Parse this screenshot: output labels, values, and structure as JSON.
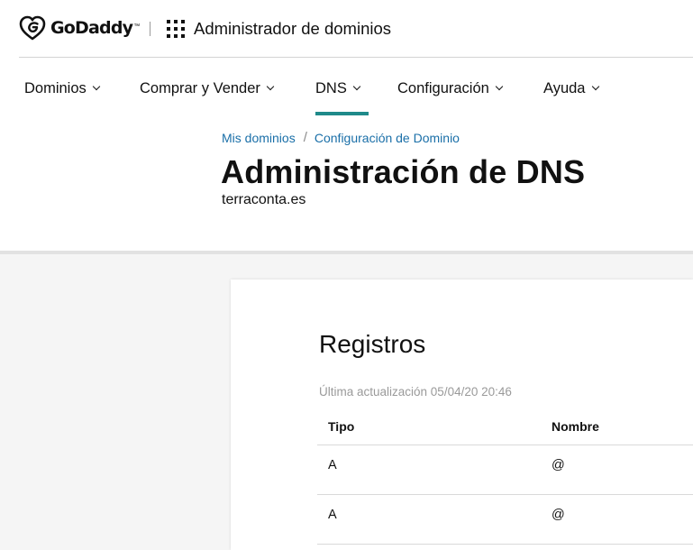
{
  "header": {
    "logo_text": "GoDaddy",
    "logo_tm": "™",
    "app_title": "Administrador de dominios"
  },
  "nav": {
    "items": [
      {
        "label": "Dominios"
      },
      {
        "label": "Comprar y Vender"
      },
      {
        "label": "DNS",
        "active": true
      },
      {
        "label": "Configuración"
      },
      {
        "label": "Ayuda"
      }
    ]
  },
  "breadcrumb": {
    "items": [
      "Mis dominios",
      "Configuración de Dominio"
    ],
    "separator": "/"
  },
  "page": {
    "title": "Administración de DNS",
    "domain": "terraconta.es"
  },
  "records": {
    "title": "Registros",
    "last_updated": "Última actualización 05/04/20 20:46",
    "columns": [
      "Tipo",
      "Nombre"
    ],
    "rows": [
      [
        "A",
        "@"
      ],
      [
        "A",
        "@"
      ]
    ]
  },
  "colors": {
    "accent": "#1f8a8a",
    "link": "#1a6fa8"
  }
}
